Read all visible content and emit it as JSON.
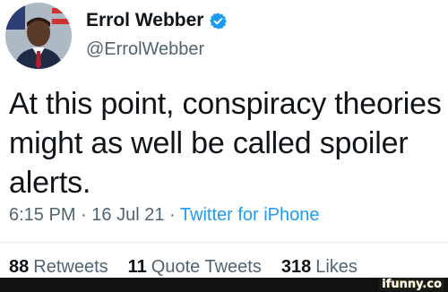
{
  "tweet": {
    "author": {
      "display_name": "Errol Webber",
      "handle": "@ErrolWebber",
      "verified": true,
      "avatar_icon": "profile-photo"
    },
    "text": "At this point, conspiracy theories might as well be called spoiler alerts.",
    "meta": {
      "time": "6:15 PM",
      "separator": "·",
      "date": "16 Jul 21",
      "source": "Twitter for iPhone"
    },
    "stats": {
      "retweets_count": "88",
      "retweets_label": "Retweets",
      "quote_tweets_count": "11",
      "quote_tweets_label": "Quote Tweets",
      "likes_count": "318",
      "likes_label": "Likes"
    }
  },
  "watermark": {
    "text": "ifunny.co"
  },
  "colors": {
    "text": "#0f1419",
    "secondary": "#536471",
    "link": "#1d9bf0",
    "verified": "#1d9bf0"
  }
}
